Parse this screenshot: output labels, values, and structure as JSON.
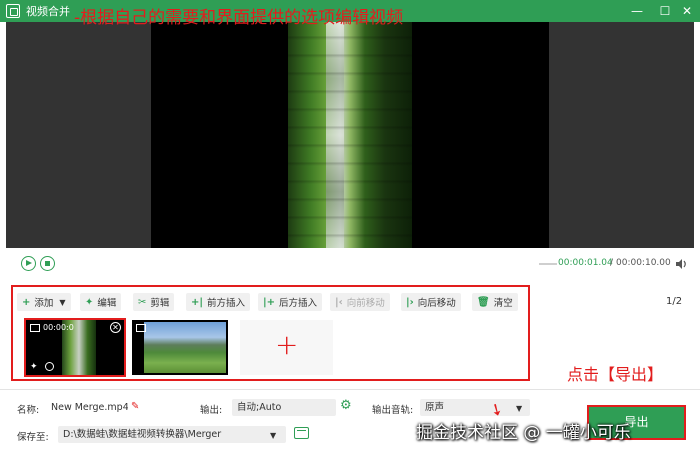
{
  "window": {
    "title": "视频合并",
    "controls": {
      "minimize": "—",
      "maximize": "☐",
      "close": "✕"
    }
  },
  "playback": {
    "current_time": "00:00:01.04",
    "separator": "/",
    "total_time": "00:00:10.00"
  },
  "annotations": {
    "edit_hint": "-根据自己的需要和界面提供的选项编辑视频",
    "export_hint": "点击【导出】"
  },
  "toolbar": {
    "buttons": [
      {
        "icon": "+",
        "label": "添加",
        "has_dropdown": true,
        "enabled": true
      },
      {
        "icon": "✦",
        "label": "编辑",
        "enabled": true
      },
      {
        "icon": "✂",
        "label": "剪辑",
        "enabled": true
      },
      {
        "icon": "+|",
        "label": "前方插入",
        "enabled": true
      },
      {
        "icon": "|+",
        "label": "后方插入",
        "enabled": true
      },
      {
        "icon": "|‹",
        "label": "向前移动",
        "enabled": false
      },
      {
        "icon": "|›",
        "label": "向后移动",
        "enabled": true
      },
      {
        "icon": "🗑",
        "label": "清空",
        "enabled": true
      }
    ],
    "page_indicator": "1/2"
  },
  "clips": [
    {
      "time": "00:00:0",
      "selected": true
    },
    {
      "selected": false
    }
  ],
  "add_clip_symbol": "+",
  "footer": {
    "name_label": "名称:",
    "name_value": "New Merge.mp4",
    "output_label": "输出:",
    "output_value": "自动;Auto",
    "audio_label": "输出音轨:",
    "audio_value": "原声",
    "save_label": "保存至:",
    "save_path": "D:\\数据蛙\\数据蛙视频转换器\\Merger",
    "export_label": "导出"
  },
  "watermark": "掘金技术社区 @ 一罐小可乐",
  "colors": {
    "accent": "#2f9e55",
    "annotation_red": "#e21d1d"
  }
}
